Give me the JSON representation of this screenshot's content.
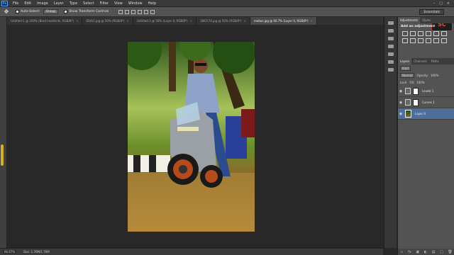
{
  "menu": {
    "logo": "Ps",
    "items": [
      "File",
      "Edit",
      "Image",
      "Layer",
      "Type",
      "Select",
      "Filter",
      "View",
      "Window",
      "Help"
    ]
  },
  "options": {
    "auto_select_label": "Auto-Select:",
    "auto_select_value": "Group",
    "show_transform_label": "Show Transform Controls",
    "workspace": "Essentials"
  },
  "tabs": [
    {
      "label": "Untitled-1 @ 100% (Brad insollents, RGB/8*)",
      "active": false
    },
    {
      "label": "ID(4)1.jpg @ 50% (RGB/8*)",
      "active": false
    },
    {
      "label": "Untitled-3 @ 50% (Layer 0, RGB/8*)",
      "active": false
    },
    {
      "label": "1867(74.jpg @ 50% (RGB/8*)",
      "active": false
    },
    {
      "label": "mobos.jpg @ 66.7% (Layer 0, RGB/8*)",
      "active": true
    }
  ],
  "status": {
    "zoom": "66.67%",
    "doc": "Doc: 1.76M/1.76M"
  },
  "panels": {
    "top_tabs": [
      "Adjustments",
      "Styles"
    ],
    "adjustments_title": "Add an adjustment",
    "layer_tabs": [
      "Layers",
      "Channels",
      "Paths"
    ],
    "kind_label": "Kind",
    "blend_mode": "Normal",
    "opacity_label": "Opacity:",
    "opacity_value": "100%",
    "lock_label": "Lock:",
    "fill_label": "Fill:",
    "fill_value": "100%",
    "layers": [
      {
        "name": "Levels 1",
        "kind": "adjustment"
      },
      {
        "name": "Curves 1",
        "kind": "adjustment"
      },
      {
        "name": "Layer 0",
        "kind": "image"
      }
    ]
  },
  "badge": "SC",
  "colors": {
    "accent": "#4aa3ff",
    "selected_layer": "#4d6f9a"
  }
}
